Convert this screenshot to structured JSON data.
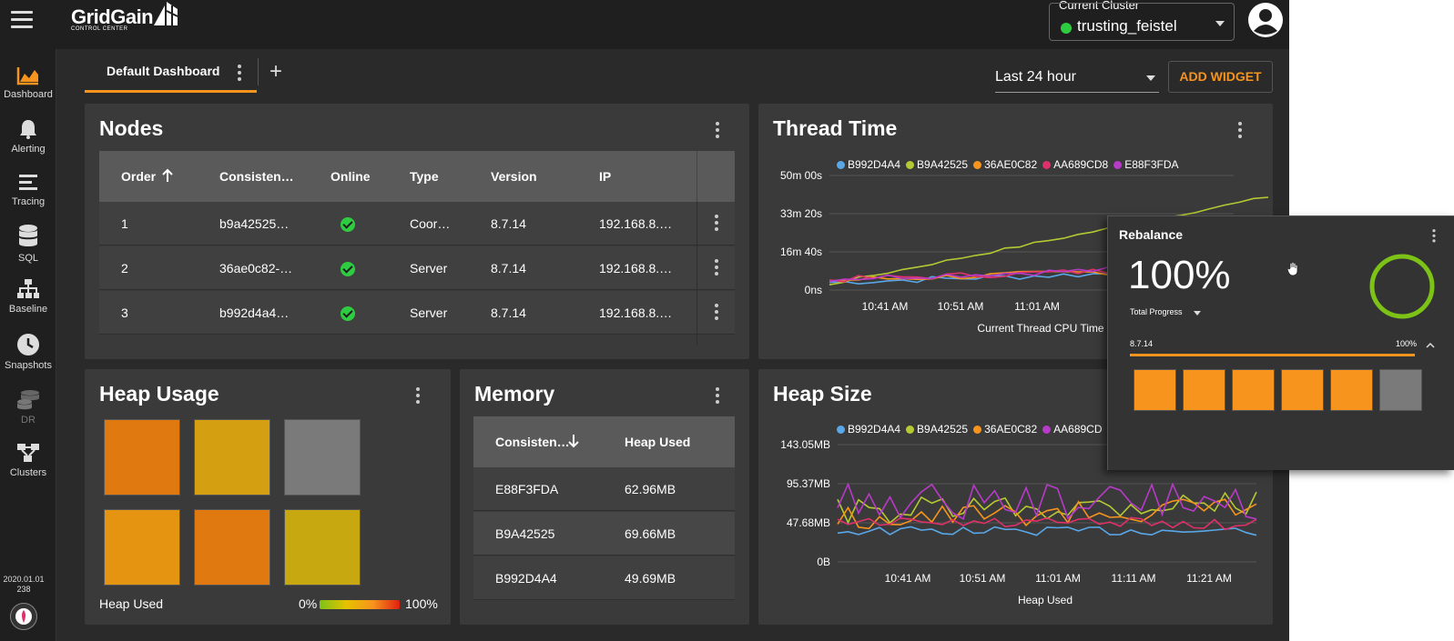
{
  "app": {
    "logo_name": "GridGain",
    "logo_sub": "CONTROL CENTER"
  },
  "cluster": {
    "label": "Current Cluster",
    "name": "trusting_feistel",
    "status_color": "#2ecc40"
  },
  "sidebar": {
    "items": [
      {
        "label": "Dashboard",
        "icon": "area-chart-icon",
        "active": true
      },
      {
        "label": "Alerting",
        "icon": "bell-icon"
      },
      {
        "label": "Tracing",
        "icon": "lines-icon"
      },
      {
        "label": "SQL",
        "icon": "database-icon"
      },
      {
        "label": "Baseline",
        "icon": "network-icon"
      },
      {
        "label": "Snapshots",
        "icon": "clock-icon"
      },
      {
        "label": "DR",
        "icon": "database-stack-icon",
        "disabled": true
      },
      {
        "label": "Clusters",
        "icon": "clusters-icon"
      }
    ],
    "version_line1": "2020.01.01",
    "version_line2": "238"
  },
  "dashboard": {
    "tab_label": "Default Dashboard",
    "time_range": "Last 24 hour",
    "add_widget": "ADD WIDGET"
  },
  "nodes": {
    "title": "Nodes",
    "columns": [
      "Order",
      "Consisten…",
      "Online",
      "Type",
      "Version",
      "IP"
    ],
    "rows": [
      {
        "order": "1",
        "consistent_id": "b9a42525…",
        "type": "Coor…",
        "version": "8.7.14",
        "ip": "192.168.8.…"
      },
      {
        "order": "2",
        "consistent_id": "36ae0c82-…",
        "type": "Server",
        "version": "8.7.14",
        "ip": "192.168.8.…"
      },
      {
        "order": "3",
        "consistent_id": "b992d4a4…",
        "type": "Server",
        "version": "8.7.14",
        "ip": "192.168.8.…"
      }
    ]
  },
  "thread_time": {
    "title": "Thread Time",
    "xlabel": "Current Thread CPU Time",
    "yticks": [
      "50m 00s",
      "33m 20s",
      "16m 40s",
      "0ns"
    ],
    "xticks": [
      "10:41 AM",
      "10:51 AM",
      "11:01 AM"
    ]
  },
  "heap_usage": {
    "title": "Heap Usage",
    "legend_label": "Heap Used",
    "scale_min": "0%",
    "scale_max": "100%",
    "cells": [
      "#e07a10",
      "#d4a012",
      "#7a7a7a",
      "#e59412",
      "#e07a10",
      "#c8a810"
    ]
  },
  "memory": {
    "title": "Memory",
    "columns": [
      "Consisten…",
      "Heap Used"
    ],
    "rows": [
      {
        "id": "E88F3FDA",
        "heap": "62.96MB"
      },
      {
        "id": "B9A42525",
        "heap": "69.66MB"
      },
      {
        "id": "B992D4A4",
        "heap": "49.69MB"
      }
    ]
  },
  "heap_size": {
    "title": "Heap Size",
    "xlabel": "Heap Used",
    "yticks": [
      "143.05MB",
      "95.37MB",
      "47.68MB",
      "0B"
    ],
    "xticks": [
      "10:41 AM",
      "10:51 AM",
      "11:01 AM",
      "11:11 AM",
      "11:21 AM"
    ]
  },
  "legend": [
    {
      "name": "B992D4A4",
      "color": "#5aa7e8"
    },
    {
      "name": "B9A42525",
      "color": "#b5c933"
    },
    {
      "name": "36AE0C82",
      "color": "#f7941d"
    },
    {
      "name": "AA689CD8",
      "color": "#e0306a"
    },
    {
      "name": "E88F3FDA",
      "color": "#b83ac8"
    }
  ],
  "heap_legend_visible": [
    "B992D4A4",
    "B9A42525",
    "36AE0C82",
    "AA689CD"
  ],
  "rebalance": {
    "title": "Rebalance",
    "percent": "100%",
    "total_progress": "Total Progress",
    "version": "8.7.14",
    "version_percent": "100%",
    "ring_color": "#7cc217",
    "cells": [
      "#f7941d",
      "#f7941d",
      "#f7941d",
      "#f7941d",
      "#f7941d",
      "#7a7a7a"
    ]
  }
}
